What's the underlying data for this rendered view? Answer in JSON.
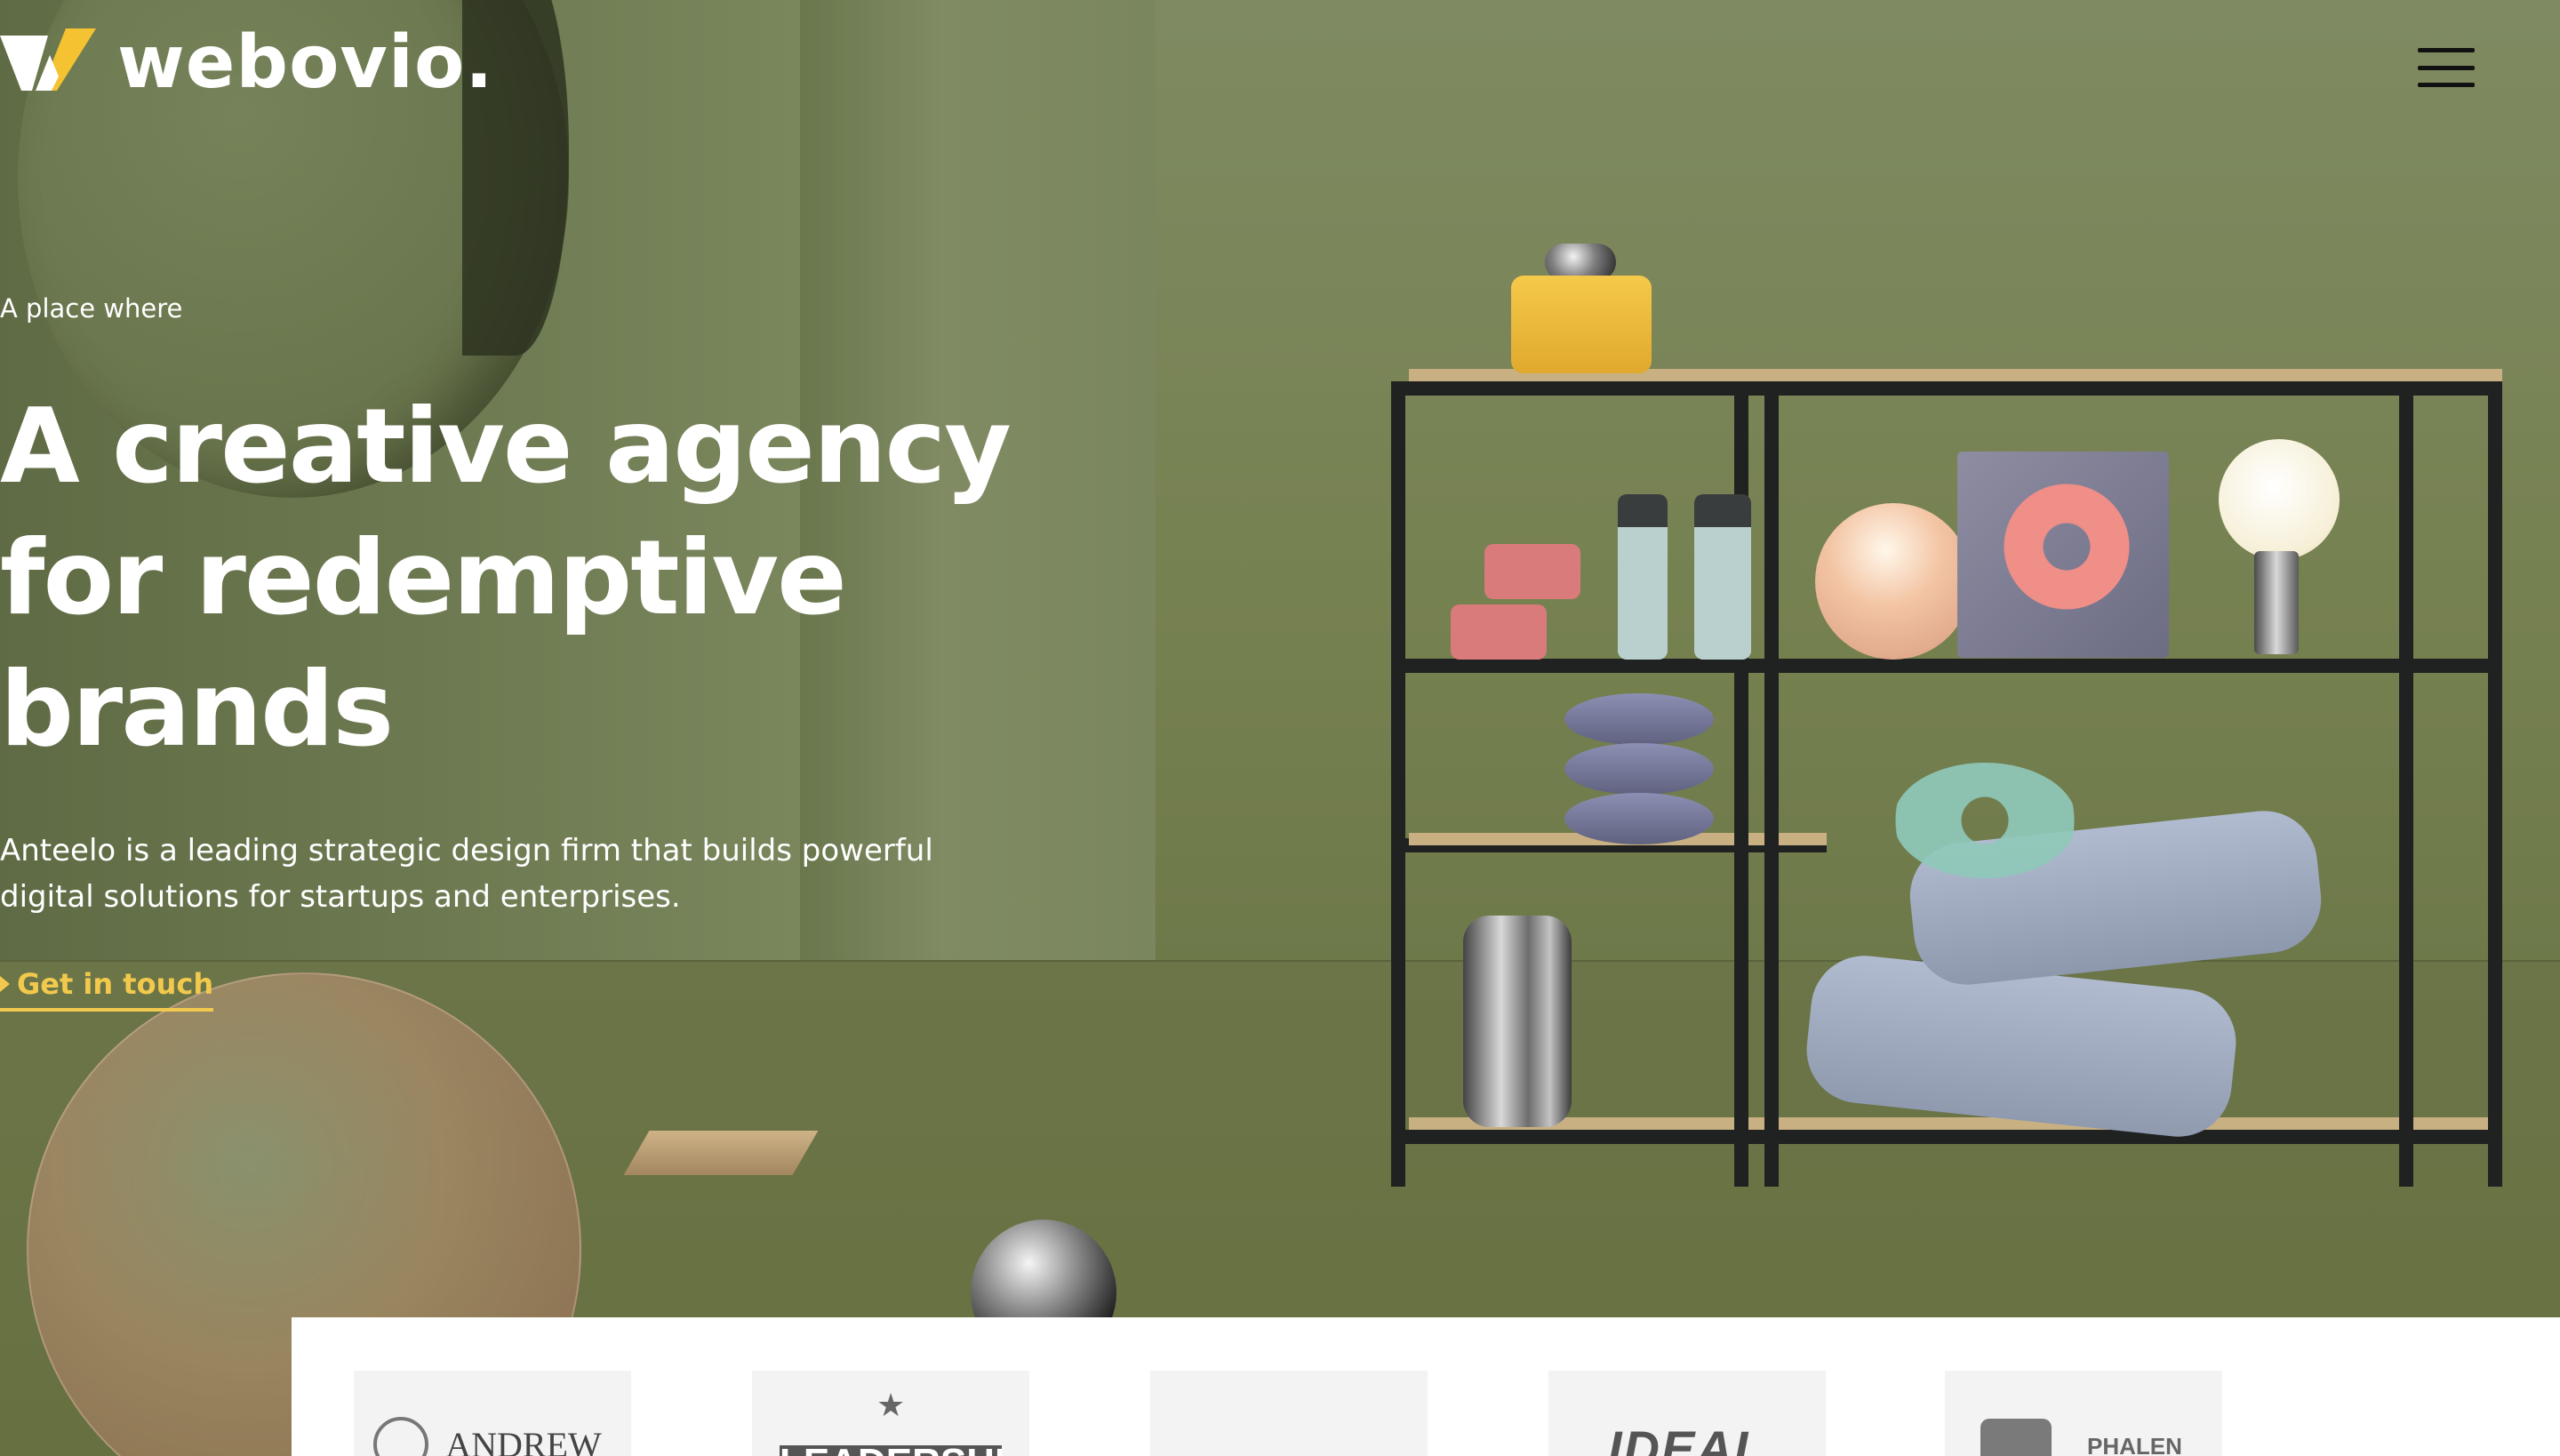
{
  "header": {
    "brand_name": "webovio.",
    "logo_icon": "webovio-v-logo",
    "menu_icon": "hamburger-menu-icon"
  },
  "hero": {
    "eyebrow": "A place where",
    "headline_lines": [
      "A creative agency",
      "for redemptive",
      "brands"
    ],
    "subtitle": "Anteelo is a leading strategic design firm that builds powerful digital solutions for startups and enterprises.",
    "cta_label": "Get in touch",
    "cta_icon": "caret-right-icon"
  },
  "clients": {
    "logos": [
      {
        "name": "ANDREW"
      },
      {
        "name": "LEADERSHIP"
      },
      {
        "name": ""
      },
      {
        "name": "IDEAL"
      },
      {
        "name": "PHALEN"
      }
    ]
  },
  "colors": {
    "accent": "#f2c94c",
    "background": "#75804f",
    "text_light": "#ffffff",
    "menu_icon": "#111111",
    "logo_yellow": "#f5c232",
    "logo_white": "#ffffff"
  }
}
